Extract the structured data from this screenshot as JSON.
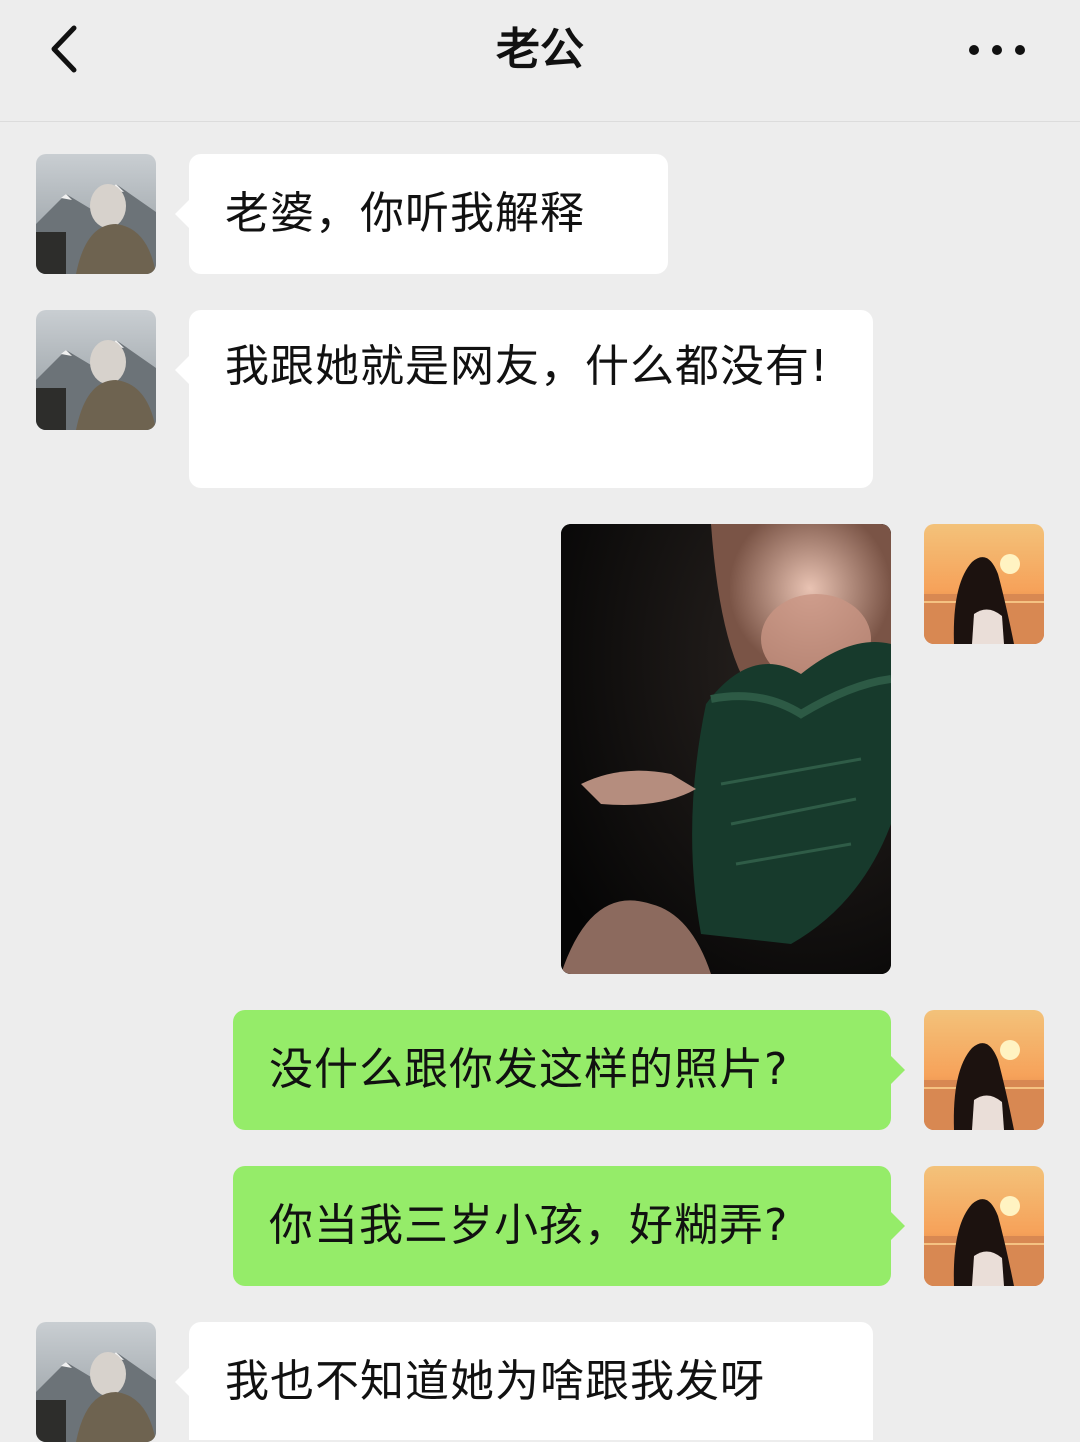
{
  "header": {
    "title": "老公",
    "back_icon": "chevron-left-icon",
    "more_icon": "more-horizontal-icon"
  },
  "colors": {
    "background": "#ededed",
    "incoming_bubble": "#ffffff",
    "outgoing_bubble": "#95ec69"
  },
  "messages": [
    {
      "sender": "other",
      "type": "text",
      "text": "老婆，你听我解释"
    },
    {
      "sender": "other",
      "type": "text",
      "text": "我跟她就是网友，什么都没有!"
    },
    {
      "sender": "me",
      "type": "image",
      "image": "photo of a person in a dark green lace dress"
    },
    {
      "sender": "me",
      "type": "text",
      "text": "没什么跟你发这样的照片?"
    },
    {
      "sender": "me",
      "type": "text",
      "text": "你当我三岁小孩，好糊弄?"
    },
    {
      "sender": "other",
      "type": "text",
      "text": "我也不知道她为啥跟我发呀"
    }
  ]
}
